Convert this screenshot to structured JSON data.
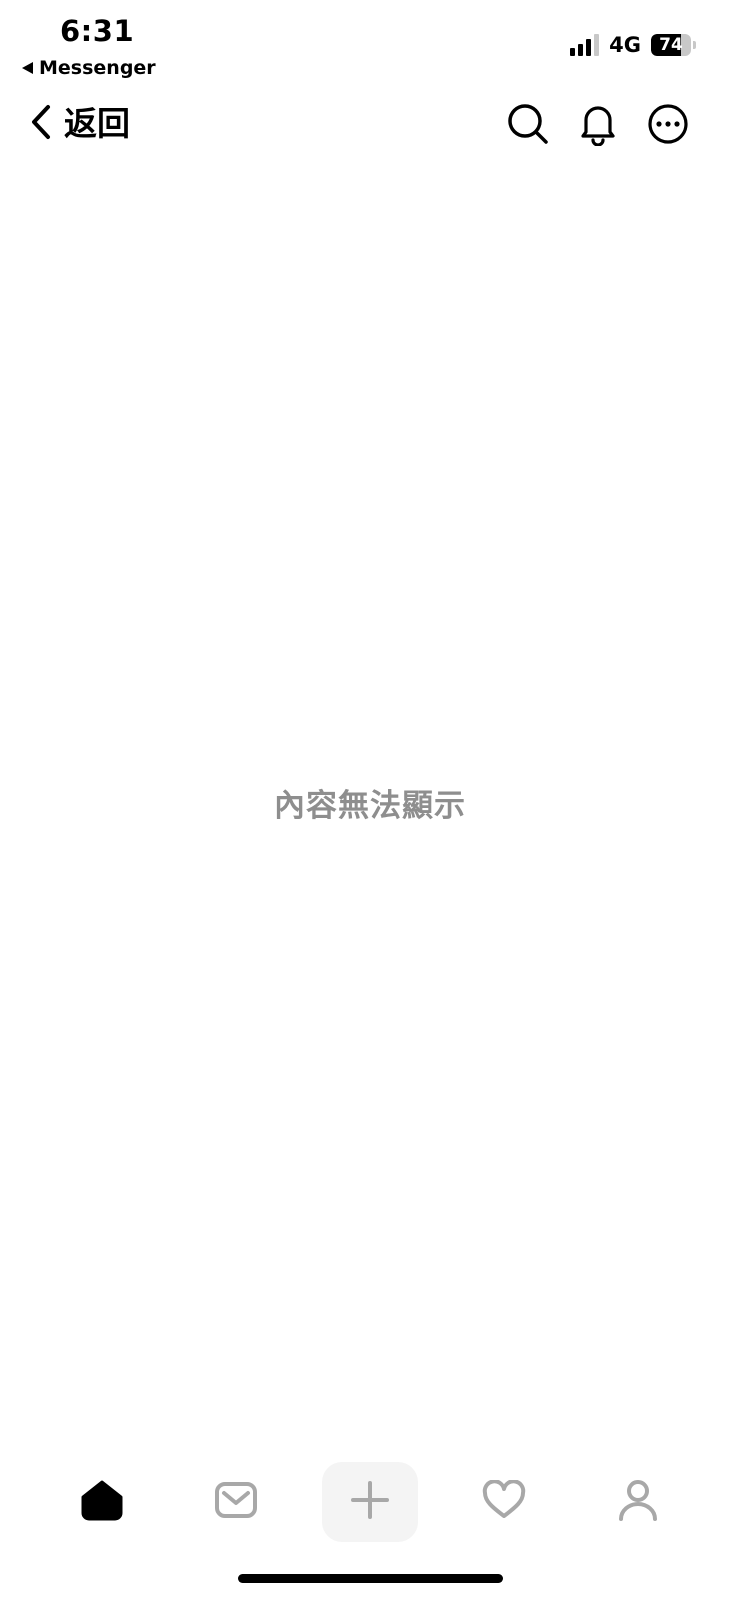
{
  "status_bar": {
    "time": "6:31",
    "back_app": "Messenger",
    "network": "4G",
    "battery_level": "74",
    "battery_percent": 74
  },
  "nav": {
    "back_label": "返回",
    "icons": [
      "search-icon",
      "bell-icon",
      "more-icon"
    ]
  },
  "main": {
    "message": "內容無法顯示"
  },
  "tab_bar": {
    "tabs": [
      "home-icon",
      "inbox-icon",
      "plus-icon",
      "heart-icon",
      "profile-icon"
    ],
    "active": "home-icon"
  },
  "colors": {
    "foreground": "#000000",
    "muted_text": "#8e8e8e",
    "inactive_icon": "#a8a8a8",
    "create_tile": "#f4f4f4",
    "background": "#ffffff"
  }
}
